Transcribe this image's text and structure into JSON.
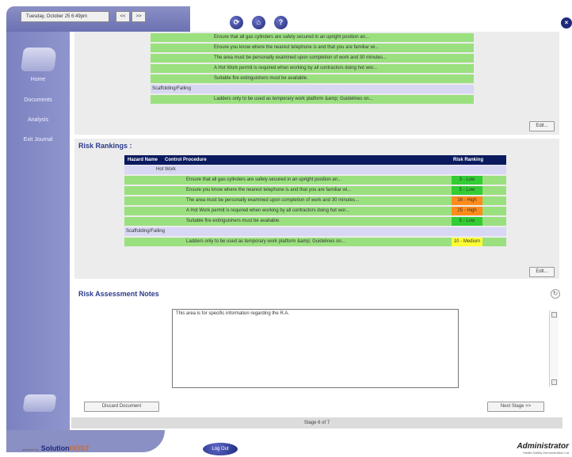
{
  "header": {
    "date_text": "Tuesday, October 25 6:49pm",
    "prev_label": "<<",
    "next_label": ">>",
    "icons": [
      "refresh-icon",
      "home-icon",
      "help-icon"
    ]
  },
  "sidebar": {
    "items": [
      {
        "label": "Home"
      },
      {
        "label": "Documents"
      },
      {
        "label": "Analysis"
      },
      {
        "label": "Exit Journal"
      }
    ]
  },
  "controls_top": {
    "rows": [
      {
        "type": "procedure",
        "text": "Ensure that all gas cylinders are safely secured in an upright position an..."
      },
      {
        "type": "procedure",
        "text": "Ensure you know where the nearest telephone is and that you are familiar wi..."
      },
      {
        "type": "procedure",
        "text": "The area must be personally examined upon completion of work and 30 minutes..."
      },
      {
        "type": "procedure",
        "text": "A Hot Work permit is required when working by all contractors doing hot wor..."
      },
      {
        "type": "procedure",
        "text": "Suitable fire extinguishers must be available."
      },
      {
        "type": "hazard",
        "text": "Scaffolding/Falling"
      },
      {
        "type": "procedure",
        "text": "Ladders only to be used as temporary work platform &amp; Guidelines on..."
      }
    ],
    "edit_label": "Edit..."
  },
  "risk_rankings": {
    "title": "Risk Rankings :",
    "columns": [
      "Hazard Name",
      "Control Procedure",
      "Risk Ranking"
    ],
    "rows": [
      {
        "hazard": "Hot Work",
        "procedure": "",
        "rank": ""
      },
      {
        "hazard": "",
        "procedure": "Ensure that all gas cylinders are safely secured in an upright position an...",
        "rank": "3 - Low",
        "color": "#33cc33"
      },
      {
        "hazard": "",
        "procedure": "Ensure you know where the nearest telephone is and that you are familiar wi...",
        "rank": "5 - Low",
        "color": "#33cc33"
      },
      {
        "hazard": "",
        "procedure": "The area must be personally examined upon completion of work and 30 minutes...",
        "rank": "16 - High",
        "color": "#ff8c1a"
      },
      {
        "hazard": "",
        "procedure": "A Hot Work permit is required when working by all contractors doing hot wor...",
        "rank": "25 - High",
        "color": "#ff8c1a"
      },
      {
        "hazard": "",
        "procedure": "Suitable fire extinguishers must be available.",
        "rank": "5 - Low",
        "color": "#33cc33"
      },
      {
        "hazard": "Scaffolding/Falling",
        "procedure": "",
        "rank": ""
      },
      {
        "hazard": "",
        "procedure": "Ladders only to be used as temporary work platform &amp; Guidelines on...",
        "rank": "10 - Medium",
        "color": "#ffff33"
      }
    ],
    "edit_label": "Edit..."
  },
  "notes": {
    "title": "Risk Assessment Notes",
    "text": "This area is for specific information regarding the R.A."
  },
  "actions": {
    "discard_label": "Discard Document",
    "next_label": "Next Stage >>",
    "stage_text": "Stage 6 of 7"
  },
  "footer": {
    "powered_by": "powered by",
    "brand_main": "Solution",
    "brand_accent": "HOST",
    "logout_label": "Log Out",
    "user_name": "Administrator",
    "user_org": "Health Safety Demonstration Ltd"
  },
  "colors": {
    "accent": "#0b1a5e",
    "sidebar": "#8a8fc4",
    "row_green": "#9be07f",
    "row_lavender": "#d8d8f4"
  }
}
